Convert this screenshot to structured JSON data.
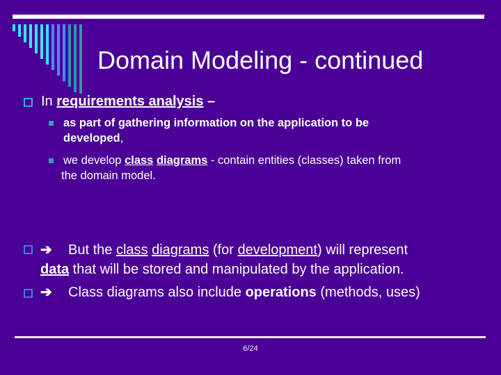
{
  "slide": {
    "title": "Domain Modeling - continued",
    "page_number": "6/24",
    "colors": {
      "background": "#4b0096",
      "text": "#ffffff",
      "bar_cyan": "#33e6ff",
      "bar_blue": "#4f86ff",
      "bar_teal": "#2a9aaa",
      "sub_bullet": "#2fa3b5",
      "hollow_bullet": "#4fa0e8"
    },
    "decor_bars": [
      "cyan",
      "cyan",
      "cyan",
      "cyan",
      "cyan",
      "cyan",
      "cyan",
      "blue",
      "blue",
      "blue",
      "teal",
      "teal",
      "teal"
    ]
  },
  "bullets": {
    "b1": {
      "prefix": "In ",
      "emph": "requirements analysis",
      "suffix": " –",
      "sub1": {
        "bold_line1": "as part of gathering information on the application to be",
        "bold_line2": "developed",
        "tail": ","
      },
      "sub2": {
        "prefix": "we develop ",
        "emph1": "class",
        "space": " ",
        "emph2": "diagrams",
        "suffix_line1": " - contain entities (classes) taken from",
        "line2": "the domain model."
      }
    },
    "b2": {
      "arrow": "➔",
      "text1": "But the ",
      "u1": "class",
      "space": " ",
      "u2": "diagrams",
      "text2": " (for ",
      "u3": "development",
      "text3": ") will represent",
      "emph_line2": "data",
      "text_line2": " that will be stored and manipulated by the application."
    },
    "b3": {
      "arrow": "➔",
      "text1": "Class diagrams also include ",
      "bold": "operations",
      "text2": " (methods, uses)"
    }
  }
}
